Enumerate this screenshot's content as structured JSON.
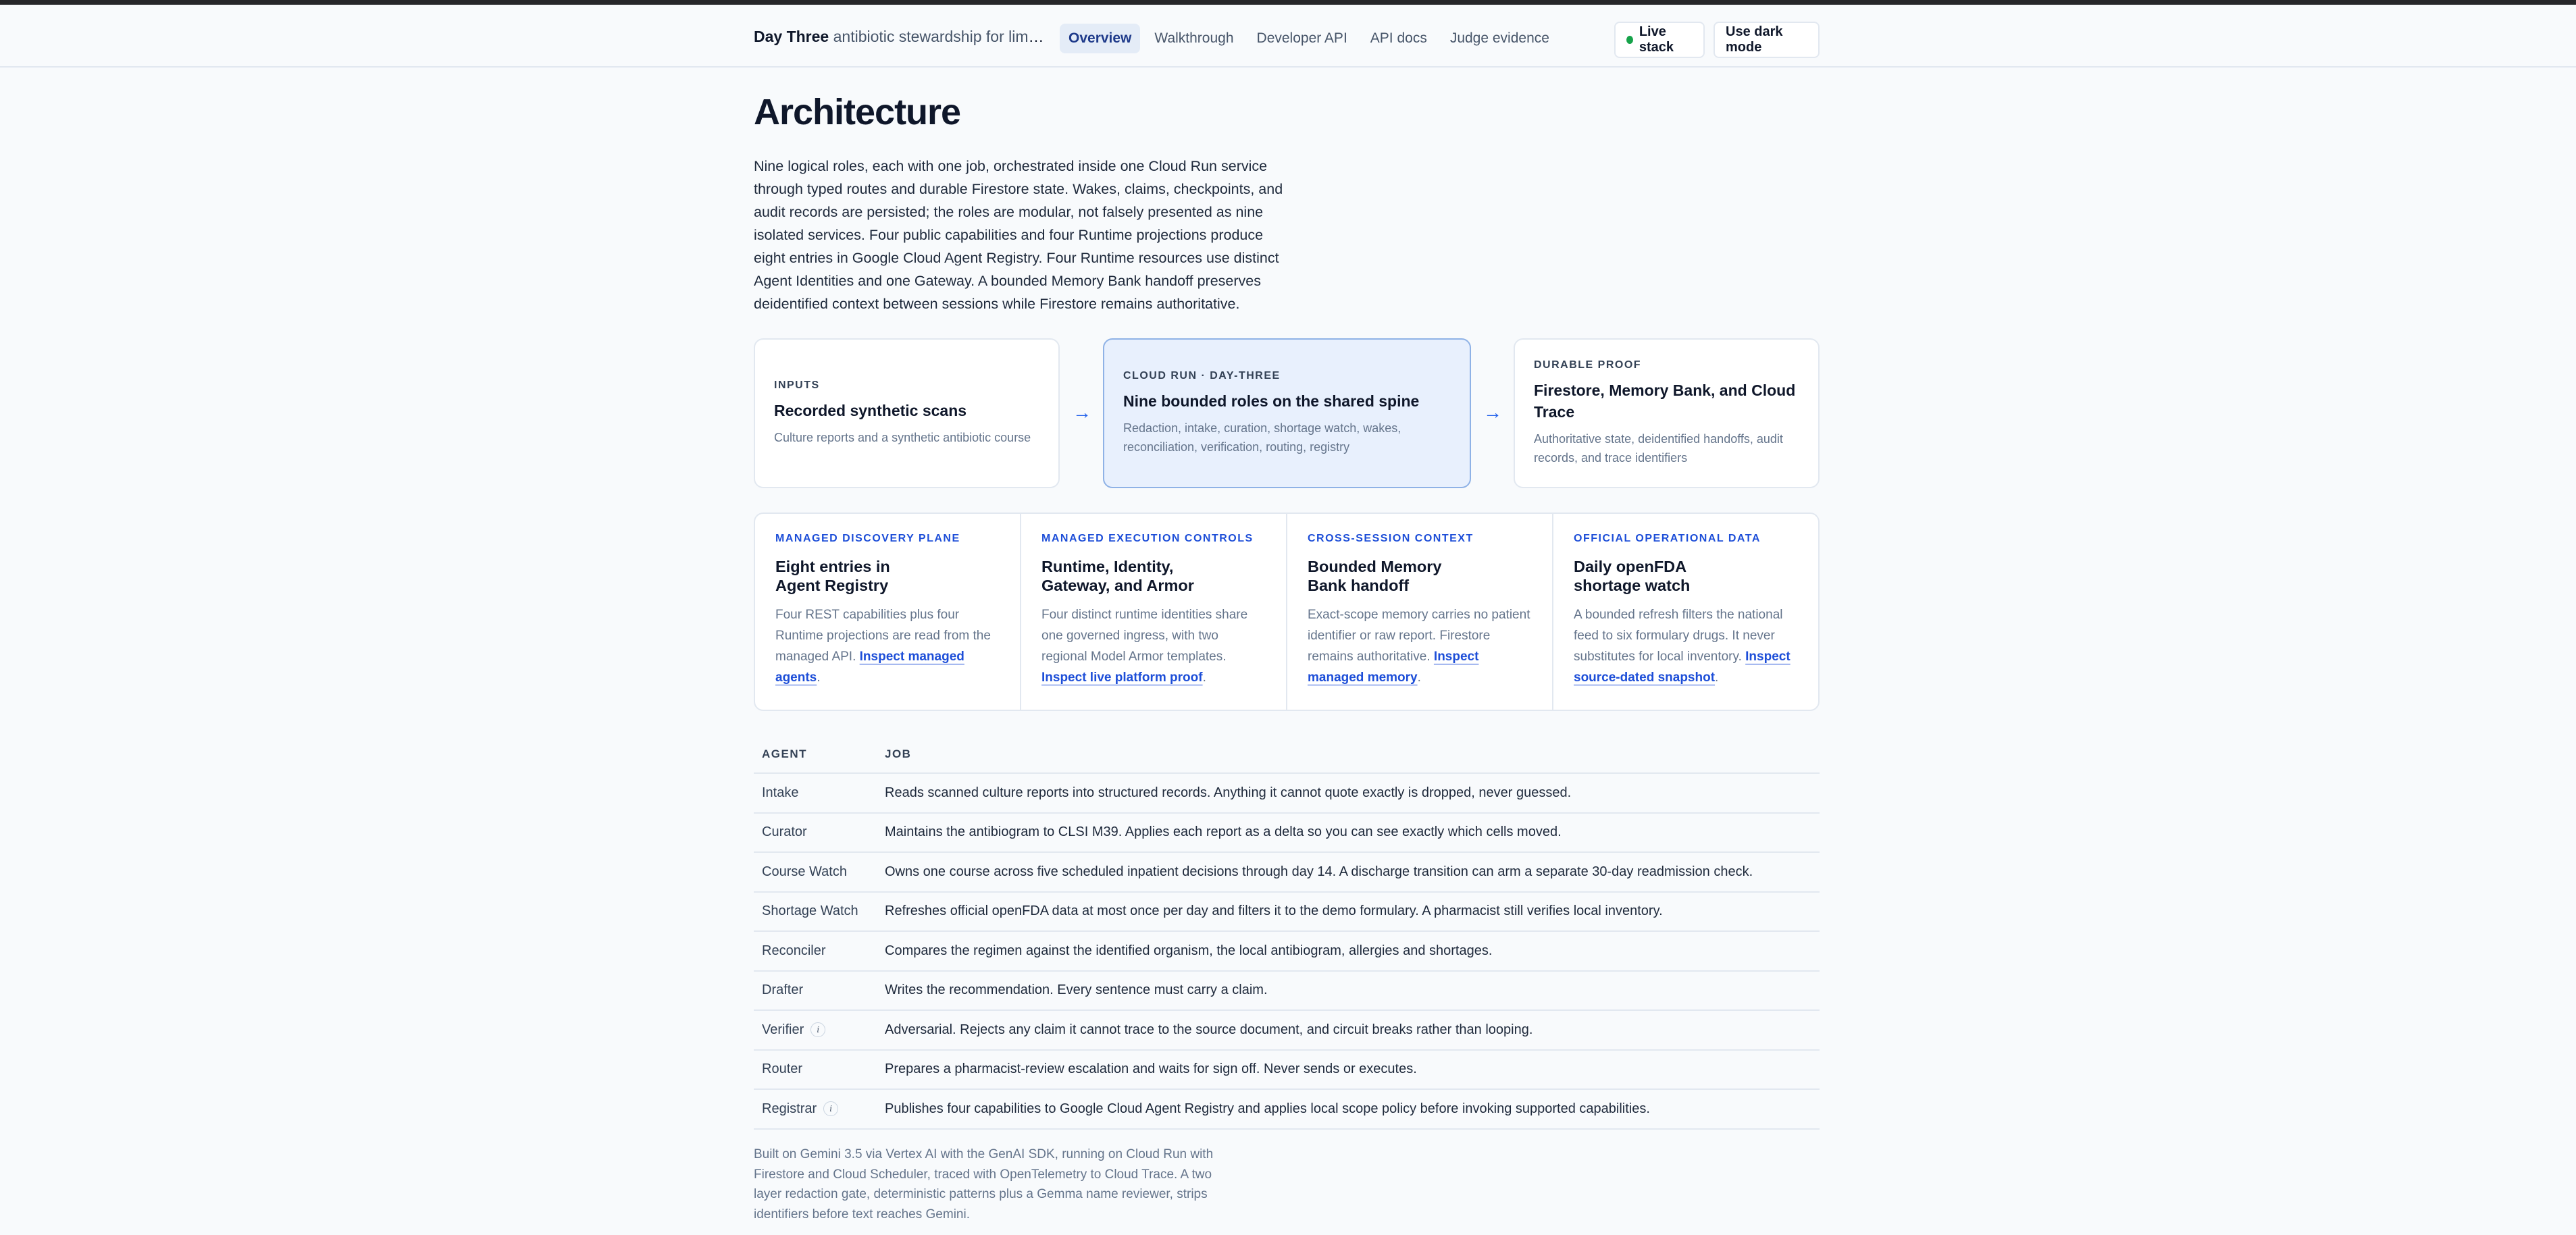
{
  "header": {
    "brand": "Day Three",
    "tagline": "antibiotic stewardship for limited ...",
    "nav": [
      {
        "label": "Overview",
        "active": true
      },
      {
        "label": "Walkthrough"
      },
      {
        "label": "Developer API"
      },
      {
        "label": "API docs"
      },
      {
        "label": "Judge evidence"
      }
    ],
    "live_label": "Live stack",
    "dark_label": "Use dark mode",
    "status_color": "#16a34a"
  },
  "page": {
    "title": "Architecture",
    "intro": "Nine logical roles, each with one job, orchestrated inside one Cloud Run service through typed routes and durable Firestore state. Wakes, claims, checkpoints, and audit records are persisted; the roles are modular, not falsely presented as nine isolated services. Four public capabilities and four Runtime projections produce eight entries in Google Cloud Agent Registry. Four Runtime resources use distinct Agent Identities and one Gateway. A bounded Memory Bank handoff preserves deidentified context between sessions while Firestore remains authoritative."
  },
  "flow": [
    {
      "eyebrow": "INPUTS",
      "title": "Recorded synthetic scans",
      "desc": "Culture reports and a synthetic antibiotic course"
    },
    {
      "eyebrow": "CLOUD RUN · DAY-THREE",
      "title": "Nine bounded roles on the shared spine",
      "desc": "Redaction, intake, curation, shortage watch, wakes, reconciliation, verification, routing, registry"
    },
    {
      "eyebrow": "DURABLE PROOF",
      "title": "Firestore, Memory Bank, and Cloud Trace",
      "desc": "Authoritative state, deidentified handoffs, audit records, and trace identifiers"
    }
  ],
  "arrow": "→",
  "capabilities": [
    {
      "eyebrow": "MANAGED DISCOVERY PLANE",
      "title": "Eight entries in Agent Registry",
      "desc": "Four REST capabilities plus four Runtime projections are read from the managed API. ",
      "link": "Inspect managed agents",
      "end": "."
    },
    {
      "eyebrow": "MANAGED EXECUTION CONTROLS",
      "title": "Runtime, Identity, Gateway, and Armor",
      "desc": "Four distinct runtime identities share one governed ingress, with two regional Model Armor templates. ",
      "link": "Inspect live platform proof",
      "end": "."
    },
    {
      "eyebrow": "CROSS-SESSION CONTEXT",
      "title": "Bounded Memory Bank handoff",
      "desc": "Exact-scope memory carries no patient identifier or raw report. Firestore remains authoritative. ",
      "link": "Inspect managed memory",
      "end": "."
    },
    {
      "eyebrow": "OFFICIAL OPERATIONAL DATA",
      "title": "Daily openFDA shortage watch",
      "desc": "A bounded refresh filters the national feed to six formulary drugs. It never substitutes for local inventory. ",
      "link": "Inspect source-dated snapshot",
      "end": "."
    }
  ],
  "table": {
    "headers": [
      "AGENT",
      "JOB"
    ],
    "info_glyph": "i",
    "rows": [
      {
        "agent": "Intake",
        "job": "Reads scanned culture reports into structured records. Anything it cannot quote exactly is dropped, never guessed."
      },
      {
        "agent": "Curator",
        "job": "Maintains the antibiogram to CLSI M39. Applies each report as a delta so you can see exactly which cells moved."
      },
      {
        "agent": "Course Watch",
        "job": "Owns one course across five scheduled inpatient decisions through day 14. A discharge transition can arm a separate 30-day readmission check."
      },
      {
        "agent": "Shortage Watch",
        "job": "Refreshes official openFDA data at most once per day and filters it to the demo formulary. A pharmacist still verifies local inventory."
      },
      {
        "agent": "Reconciler",
        "job": "Compares the regimen against the identified organism, the local antibiogram, allergies and shortages."
      },
      {
        "agent": "Drafter",
        "job": "Writes the recommendation. Every sentence must carry a claim."
      },
      {
        "agent": "Verifier",
        "info": true,
        "job": "Adversarial. Rejects any claim it cannot trace to the source document, and circuit breaks rather than looping."
      },
      {
        "agent": "Router",
        "job": "Prepares a pharmacist-review escalation and waits for sign off. Never sends or executes."
      },
      {
        "agent": "Registrar",
        "info": true,
        "job": "Publishes four capabilities to Google Cloud Agent Registry and applies local scope policy before invoking supported capabilities."
      }
    ]
  },
  "footnote": "Built on Gemini 3.5 via Vertex AI with the GenAI SDK, running on Cloud Run with Firestore and Cloud Scheduler, traced with OpenTelemetry to Cloud Trace. A two layer redaction gate, deterministic patterns plus a Gemma name reviewer, strips identifiers before text reaches Gemini."
}
